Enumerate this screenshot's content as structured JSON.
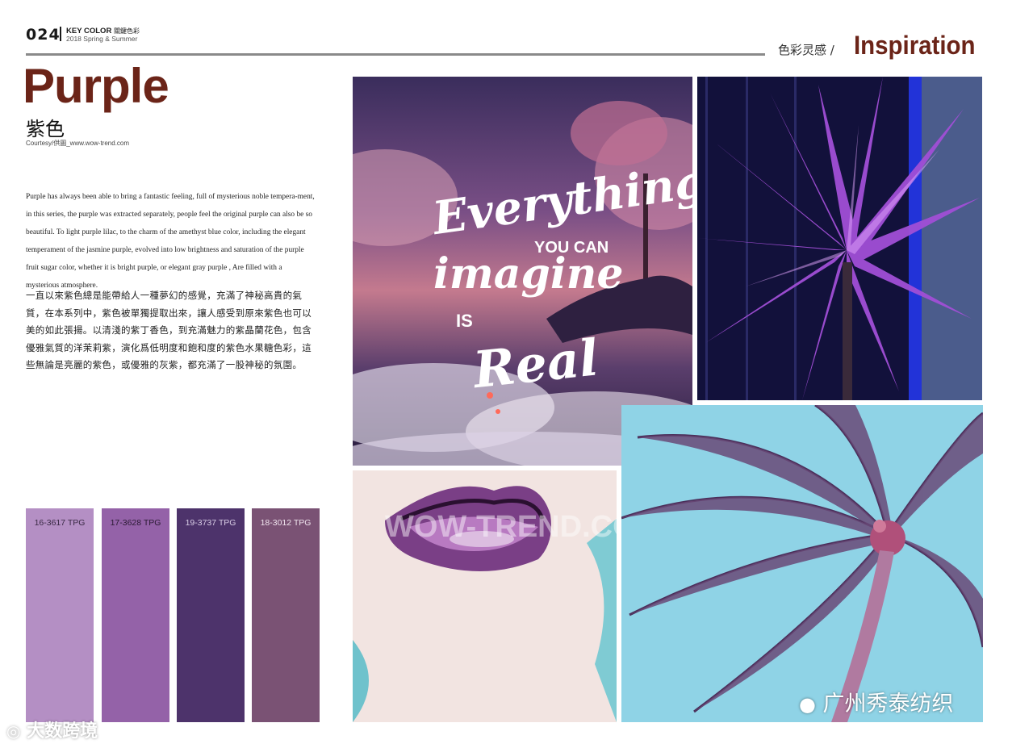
{
  "header": {
    "page_number": "024",
    "key_color_label": "KEY COLOR",
    "key_color_cn": "關鍵色彩",
    "season": "2018 Spring & Summer",
    "inspiration_cn": "色彩灵感 /",
    "inspiration_en": "Inspiration"
  },
  "title": {
    "en": "Purple",
    "cn": "紫色",
    "courtesy": "Courtesy/供圖_www.wow-trend.com"
  },
  "body": {
    "en": "Purple has always been able to bring a fantastic feeling, full of mysterious noble tempera-ment, in this series, the purple was extracted separately, people feel the original purple can also be so beautiful. To light purple lilac, to the charm of the amethyst blue color, including the elegant temperament of the jasmine purple, evolved into low brightness and saturation of the purple fruit sugar color, whether it is bright purple, or elegant gray purple , Are filled with a mysterious atmosphere.",
    "cn": "一直以來紫色總是能帶給人一種夢幻的感覺，充滿了神秘高貴的氣質，在本系列中，紫色被單獨提取出來，讓人感受到原來紫色也可以美的如此張揚。以清淺的紫丁香色，到充滿魅力的紫晶蘭花色，包含優雅氣質的洋茉莉紫，演化爲低明度和飽和度的紫色水果糖色彩，這些無論是亮麗的紫色，或優雅的灰紫，都充滿了一股神秘的氛圍。"
  },
  "swatches": [
    {
      "code": "16-3617 TPG",
      "color": "#b48fc4",
      "text_color": "#3a2a45"
    },
    {
      "code": "17-3628 TPG",
      "color": "#9462a8",
      "text_color": "#2a1a33"
    },
    {
      "code": "19-3737 TPG",
      "color": "#4d336b",
      "text_color": "#d9cde6"
    },
    {
      "code": "18-3012 TPG",
      "color": "#7a5274",
      "text_color": "#f0e4ee"
    }
  ],
  "poster": {
    "line1": "Everything",
    "line2": "YOU CAN",
    "line3": "imagine",
    "line4": "IS",
    "line5": "Real"
  },
  "watermarks": {
    "left": "大数跨境",
    "right": "广州秀泰纺织",
    "center": "WOW-TREND.COM"
  },
  "colors": {
    "title": "#6b2418",
    "rule": "#8a8a8a"
  }
}
